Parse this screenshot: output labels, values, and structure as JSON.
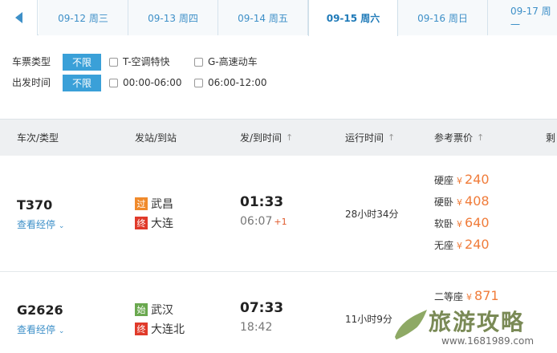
{
  "dates": [
    {
      "label": "09-12 周三"
    },
    {
      "label": "09-13 周四"
    },
    {
      "label": "09-14 周五"
    },
    {
      "label": "09-15 周六",
      "active": true
    },
    {
      "label": "09-16 周日"
    },
    {
      "label": "09-17 周一"
    }
  ],
  "filters": {
    "ticket_type_label": "车票类型",
    "ticket_type_all": "不限",
    "opt_t": "T-空调特快",
    "opt_g": "G-高速动车",
    "depart_time_label": "出发时间",
    "depart_time_all": "不限",
    "opt_time1": "00:00-06:00",
    "opt_time2": "06:00-12:00"
  },
  "table_header": {
    "col_train": "车次/类型",
    "col_station": "发站/到站",
    "col_time": "发/到时间",
    "col_duration": "运行时间",
    "col_price": "参考票价",
    "col_remain": "剩"
  },
  "trains": [
    {
      "number": "T370",
      "route_link": "查看经停",
      "from_badge": "过",
      "from": "武昌",
      "to_badge": "终",
      "to": "大连",
      "depart": "01:33",
      "arrive": "06:07",
      "arrive_plus": "+1",
      "duration": "28小时34分",
      "prices": [
        {
          "seat": "硬座",
          "yen": "¥",
          "amount": "240"
        },
        {
          "seat": "硬卧",
          "yen": "¥",
          "amount": "408"
        },
        {
          "seat": "软卧",
          "yen": "¥",
          "amount": "640"
        },
        {
          "seat": "无座",
          "yen": "¥",
          "amount": "240"
        }
      ]
    },
    {
      "number": "G2626",
      "route_link": "查看经停",
      "from_badge": "始",
      "from": "武汉",
      "to_badge": "终",
      "to": "大连北",
      "depart": "07:33",
      "arrive": "18:42",
      "duration": "11小时9分",
      "prices": [
        {
          "seat": "二等座",
          "yen": "¥",
          "amount": "871"
        }
      ]
    }
  ],
  "watermark": {
    "text": "旅游攻略",
    "url": "www.1681989.com"
  },
  "colors": {
    "accent": "#3aa0d8",
    "price": "#f07c3a",
    "pass_badge": "#f08a2b",
    "end_badge": "#e03a2a",
    "start_badge": "#6aa84f"
  }
}
